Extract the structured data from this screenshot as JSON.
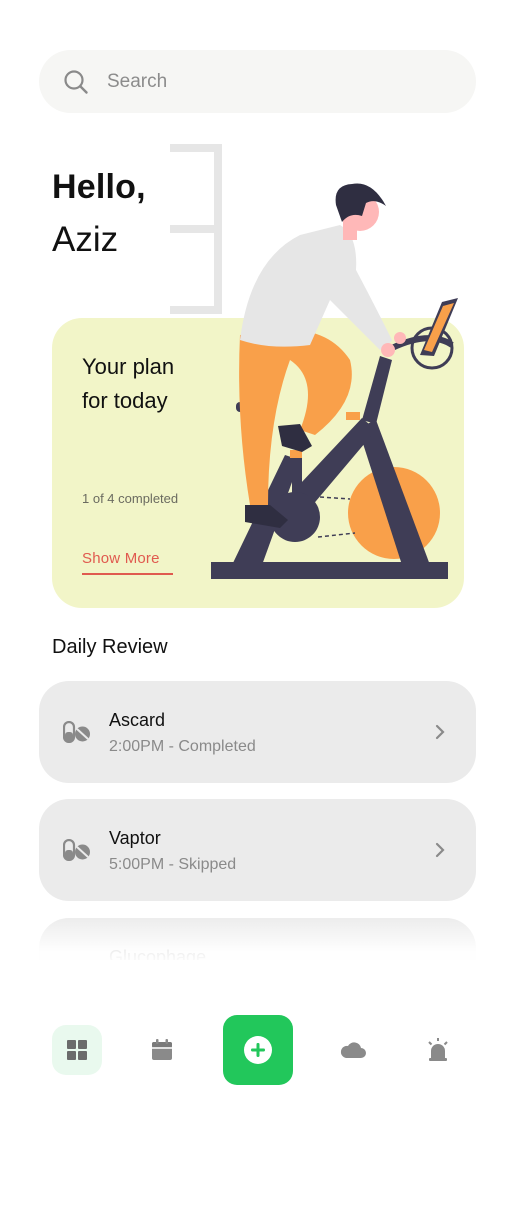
{
  "search": {
    "placeholder": "Search"
  },
  "greeting": {
    "hello": "Hello,",
    "name": "Aziz"
  },
  "plan_card": {
    "title": "Your plan for today",
    "progress": "1 of 4 completed",
    "show_more": "Show More"
  },
  "daily_review": {
    "title": "Daily Review",
    "items": [
      {
        "name": "Ascard",
        "detail": "2:00PM - Completed"
      },
      {
        "name": "Vaptor",
        "detail": "5:00PM - Skipped"
      },
      {
        "name": "Glucophage",
        "detail": ""
      }
    ]
  },
  "nav": {
    "items": [
      {
        "icon": "dashboard-grid-icon",
        "active": true
      },
      {
        "icon": "calendar-icon",
        "active": false
      },
      {
        "icon": "add-circle-icon",
        "active": false
      },
      {
        "icon": "cloud-icon",
        "active": false
      },
      {
        "icon": "alarm-siren-icon",
        "active": false
      }
    ]
  },
  "colors": {
    "accent_green": "#22c75b",
    "card_yellow": "#f2f5c8",
    "link_red": "#e05a4f",
    "illustration_orange": "#f9a04a",
    "illustration_dark": "#3f3d56"
  }
}
